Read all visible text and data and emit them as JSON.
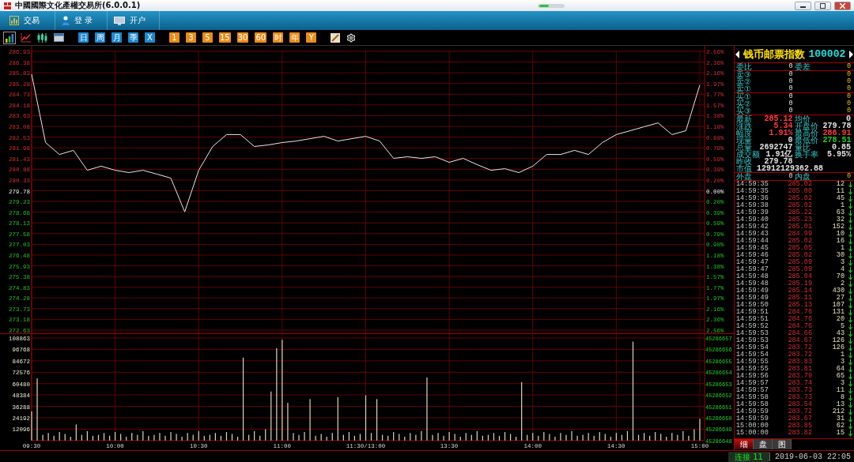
{
  "window": {
    "title": "中國國際文化產權交易所(6.0.0.1)"
  },
  "menu": [
    {
      "kind": "chart",
      "label": "交易"
    },
    {
      "kind": "user",
      "label": "登 录"
    },
    {
      "kind": "monitor",
      "label": "开户"
    }
  ],
  "toolbar": [
    {
      "kind": "bars",
      "selected": true
    },
    {
      "kind": "line",
      "selected": false
    },
    {
      "kind": "candles",
      "selected": false
    },
    {
      "kind": "window",
      "selected": false
    },
    {
      "kind": "period",
      "label": "日",
      "selected": false
    },
    {
      "kind": "period",
      "label": "周",
      "selected": false
    },
    {
      "kind": "period",
      "label": "月",
      "selected": false
    },
    {
      "kind": "period",
      "label": "季",
      "selected": false
    },
    {
      "kind": "period",
      "label": "X",
      "selected": false
    },
    {
      "kind": "minutes",
      "label": "1",
      "selected": false
    },
    {
      "kind": "minutes",
      "label": "3",
      "selected": false
    },
    {
      "kind": "minutes",
      "label": "5",
      "selected": false
    },
    {
      "kind": "minutes",
      "label": "15",
      "selected": false
    },
    {
      "kind": "minutes",
      "label": "30",
      "selected": false
    },
    {
      "kind": "minutes",
      "label": "60",
      "selected": false
    },
    {
      "kind": "minutes",
      "label": "时",
      "selected": false
    },
    {
      "kind": "minutes",
      "label": "年",
      "selected": false
    },
    {
      "kind": "minutes",
      "label": "Y",
      "selected": false
    },
    {
      "kind": "draw",
      "selected": false
    },
    {
      "kind": "settings",
      "selected": false
    }
  ],
  "price_chart": {
    "percent_labels": [
      "2.56%",
      "2.36%",
      "2.16%",
      "1.97%",
      "1.77%",
      "1.57%",
      "1.38%",
      "1.18%",
      "0.98%",
      "0.79%",
      "0.59%",
      "0.39%",
      "0.20%",
      "0.00%",
      "0.20%",
      "0.39%",
      "0.59%",
      "0.79%",
      "0.98%",
      "1.18%",
      "1.38%",
      "1.57%",
      "1.77%",
      "1.97%",
      "2.16%",
      "2.36%",
      "2.56%"
    ],
    "chart_data": {
      "type": "line",
      "grid": true,
      "ylim": [
        272.63,
        286.93
      ],
      "categories": [
        null,
        null,
        null,
        null,
        null,
        null,
        null,
        null,
        null,
        null,
        null,
        null,
        null,
        null,
        null,
        null,
        null,
        null,
        null,
        null,
        null,
        null,
        null,
        null,
        null,
        null,
        null,
        null,
        null,
        null,
        null,
        null,
        null,
        null,
        null,
        null,
        null,
        null,
        null,
        null,
        null,
        null,
        null,
        null,
        null,
        null,
        null,
        null,
        null
      ],
      "yticks": [
        {
          "value": 286.93,
          "label": "286.93"
        },
        {
          "value": 286.38,
          "label": "286.38"
        },
        {
          "value": 285.83,
          "label": "285.83"
        },
        {
          "value": 285.28,
          "label": "285.28"
        },
        {
          "value": 284.73,
          "label": "284.73"
        },
        {
          "value": 284.18,
          "label": "284.18"
        },
        {
          "value": 283.63,
          "label": "283.63"
        },
        {
          "value": 283.08,
          "label": "283.08"
        },
        {
          "value": 282.53,
          "label": "282.53"
        },
        {
          "value": 281.98,
          "label": "281.98"
        },
        {
          "value": 281.43,
          "label": "281.43"
        },
        {
          "value": 280.88,
          "label": "280.88"
        },
        {
          "value": 280.33,
          "label": "280.33"
        },
        {
          "value": 279.78,
          "label": "279.78"
        },
        {
          "value": 279.23,
          "label": "279.23"
        },
        {
          "value": 278.68,
          "label": "278.68"
        },
        {
          "value": 278.13,
          "label": "278.13"
        },
        {
          "value": 277.58,
          "label": "277.58"
        },
        {
          "value": 277.03,
          "label": "277.03"
        },
        {
          "value": 276.48,
          "label": "276.48"
        },
        {
          "value": 275.93,
          "label": "275.93"
        },
        {
          "value": 275.38,
          "label": "275.38"
        },
        {
          "value": 274.83,
          "label": "274.83"
        },
        {
          "value": 274.28,
          "label": "274.28"
        },
        {
          "value": 273.73,
          "label": "273.73"
        },
        {
          "value": 273.18,
          "label": "273.18"
        },
        {
          "value": 272.63,
          "label": "272.63"
        }
      ],
      "series": [
        {
          "color": "#e8e8e8",
          "values": [
            285.75,
            282.25,
            281.64,
            281.85,
            280.83,
            281.04,
            280.83,
            280.71,
            280.83,
            280.63,
            280.43,
            278.7,
            280.83,
            282.05,
            282.66,
            282.66,
            282.05,
            282.13,
            282.25,
            282.33,
            282.45,
            282.57,
            282.33,
            282.45,
            282.57,
            282.33,
            281.44,
            281.52,
            281.44,
            281.52,
            281.24,
            281.44,
            281.12,
            280.83,
            280.91,
            280.71,
            281.04,
            281.64,
            281.64,
            281.85,
            281.64,
            282.25,
            282.66,
            282.86,
            283.06,
            283.26,
            282.66,
            282.86,
            285.2
          ]
        }
      ]
    }
  },
  "volume_chart": {
    "right_labels": [
      "45286657",
      "45286656",
      "45286655",
      "45286654",
      "45286653",
      "45286652",
      "45286651",
      "45286650",
      "45286649",
      "45286648"
    ],
    "chart_data": {
      "type": "bar",
      "grid": true,
      "ylim": [
        0,
        108863
      ],
      "categories": [
        "09:30",
        null,
        null,
        null,
        null,
        null,
        null,
        null,
        null,
        null,
        null,
        null,
        null,
        null,
        null,
        "10:00",
        null,
        null,
        null,
        null,
        null,
        null,
        null,
        null,
        null,
        null,
        null,
        null,
        null,
        null,
        "10:30",
        null,
        null,
        null,
        null,
        null,
        null,
        null,
        null,
        null,
        null,
        null,
        null,
        null,
        null,
        "11:00",
        null,
        null,
        null,
        null,
        null,
        null,
        null,
        null,
        null,
        null,
        null,
        null,
        null,
        null,
        "11:30/13:00",
        null,
        null,
        null,
        null,
        null,
        null,
        null,
        null,
        null,
        null,
        null,
        null,
        null,
        null,
        "13:30",
        null,
        null,
        null,
        null,
        null,
        null,
        null,
        null,
        null,
        null,
        null,
        null,
        null,
        null,
        "14:00",
        null,
        null,
        null,
        null,
        null,
        null,
        null,
        null,
        null,
        null,
        null,
        null,
        null,
        null,
        "14:30",
        null,
        null,
        null,
        null,
        null,
        null,
        null,
        null,
        null,
        null,
        null,
        null,
        null,
        null,
        "15:00"
      ],
      "yticks": [
        108863,
        96768,
        84672,
        72576,
        60480,
        48384,
        36288,
        24192,
        12096
      ],
      "series": [
        {
          "color": "#d8d8b8",
          "values": [
            31000,
            66000,
            6000,
            8000,
            5000,
            9000,
            7000,
            4000,
            17000,
            6000,
            10000,
            5000,
            6000,
            8000,
            5000,
            9000,
            7000,
            4000,
            8000,
            6000,
            10000,
            5000,
            6000,
            8000,
            5000,
            9000,
            7000,
            4000,
            8000,
            6000,
            10000,
            5000,
            6000,
            8000,
            5000,
            9000,
            7000,
            4000,
            88000,
            6000,
            10000,
            5000,
            12000,
            52000,
            98000,
            107000,
            40000,
            8000,
            6000,
            9000,
            44000,
            5000,
            7000,
            4000,
            8000,
            46000,
            6000,
            9000,
            5000,
            7000,
            48000,
            8000,
            44000,
            6000,
            5000,
            9000,
            7000,
            4000,
            8000,
            6000,
            10000,
            67000,
            6000,
            8000,
            5000,
            9000,
            7000,
            4000,
            8000,
            6000,
            10000,
            5000,
            6000,
            8000,
            5000,
            9000,
            7000,
            4000,
            62000,
            6000,
            8000,
            5000,
            9000,
            7000,
            4000,
            8000,
            6000,
            10000,
            5000,
            6000,
            8000,
            5000,
            9000,
            7000,
            4000,
            8000,
            6000,
            10000,
            105000,
            6000,
            8000,
            5000,
            9000,
            7000,
            4000,
            8000,
            6000,
            10000,
            5000,
            12000,
            23000
          ]
        }
      ]
    }
  },
  "quote": {
    "name": "钱币邮票指数",
    "code": "100002",
    "ratio": [
      {
        "label": "委比",
        "value": "0"
      },
      {
        "label": "委差",
        "value": "0"
      }
    ],
    "sells": [
      {
        "label": "卖③",
        "price": "0",
        "volume": "0"
      },
      {
        "label": "卖②",
        "price": "0",
        "volume": "0"
      },
      {
        "label": "卖①",
        "price": "0",
        "volume": "0"
      }
    ],
    "buys": [
      {
        "label": "买①",
        "price": "0",
        "volume": "0"
      },
      {
        "label": "买②",
        "price": "0",
        "volume": "0"
      },
      {
        "label": "买③",
        "price": "0",
        "volume": "0"
      }
    ],
    "stats": [
      [
        {
          "kind": "half",
          "label": "最新",
          "value": "285.12",
          "color": "#ff3c3c"
        },
        {
          "kind": "half",
          "label": "均价",
          "value": "0",
          "color": "#e0e0e0"
        }
      ],
      [
        {
          "kind": "half",
          "label": "涨跌",
          "value": "5.34",
          "color": "#ff3c3c"
        },
        {
          "kind": "half",
          "label": "开盘价",
          "value": "279.78",
          "color": "#e0e0e0"
        }
      ],
      [
        {
          "kind": "half",
          "label": "幅度",
          "value": "1.91%",
          "color": "#ff3c3c"
        },
        {
          "kind": "half",
          "label": "最高价",
          "value": "286.91",
          "color": "#ff3c3c"
        }
      ],
      [
        {
          "kind": "half",
          "label": "现量",
          "value": "0",
          "color": "#e0e0e0"
        },
        {
          "kind": "half",
          "label": "最低价",
          "value": "278.51",
          "color": "#20d020"
        }
      ],
      [
        {
          "kind": "half",
          "label": "总量",
          "value": "2692747",
          "color": "#e0e0e0"
        },
        {
          "kind": "half",
          "label": "量比",
          "value": "0.85",
          "color": "#e0e0e0"
        }
      ],
      [
        {
          "kind": "half",
          "label": "成交额",
          "value": "1.91亿",
          "color": "#e0e0e0"
        },
        {
          "kind": "half",
          "label": "换手率",
          "value": "5.95%",
          "color": "#e0e0e0"
        }
      ],
      [
        {
          "kind": "half",
          "label": "昨收",
          "value": "279.78",
          "color": "#e0e0e0"
        }
      ],
      [
        {
          "kind": "wide",
          "label": "市值",
          "value": "12912129362.88",
          "color": "#e0e0e0"
        }
      ]
    ],
    "outer_inner": [
      {
        "label": "外盘",
        "value": "0"
      },
      {
        "label": "内盘",
        "value": "0"
      }
    ]
  },
  "ticks": [
    {
      "time": "14:59:35",
      "price": "285.02",
      "volume": "12"
    },
    {
      "time": "14:59:35",
      "price": "285.00",
      "volume": "11"
    },
    {
      "time": "14:59:36",
      "price": "285.02",
      "volume": "45"
    },
    {
      "time": "14:59:38",
      "price": "285.02",
      "volume": "1"
    },
    {
      "time": "14:59:39",
      "price": "285.22",
      "volume": "63"
    },
    {
      "time": "14:59:40",
      "price": "285.23",
      "volume": "32"
    },
    {
      "time": "14:59:42",
      "price": "285.01",
      "volume": "152"
    },
    {
      "time": "14:59:43",
      "price": "284.99",
      "volume": "10"
    },
    {
      "time": "14:59:44",
      "price": "285.02",
      "volume": "16"
    },
    {
      "time": "14:59:45",
      "price": "285.05",
      "volume": "1"
    },
    {
      "time": "14:59:46",
      "price": "285.02",
      "volume": "30"
    },
    {
      "time": "14:59:47",
      "price": "285.09",
      "volume": "3"
    },
    {
      "time": "14:59:47",
      "price": "285.09",
      "volume": "4"
    },
    {
      "time": "14:59:48",
      "price": "285.04",
      "volume": "70"
    },
    {
      "time": "14:59:48",
      "price": "285.19",
      "volume": "2"
    },
    {
      "time": "14:59:49",
      "price": "285.14",
      "volume": "430"
    },
    {
      "time": "14:59:49",
      "price": "285.11",
      "volume": "27"
    },
    {
      "time": "14:59:50",
      "price": "285.13",
      "volume": "107"
    },
    {
      "time": "14:59:51",
      "price": "284.76",
      "volume": "131"
    },
    {
      "time": "14:59:51",
      "price": "284.76",
      "volume": "20"
    },
    {
      "time": "14:59:52",
      "price": "284.76",
      "volume": "5"
    },
    {
      "time": "14:59:53",
      "price": "284.66",
      "volume": "43"
    },
    {
      "time": "14:59:53",
      "price": "284.67",
      "volume": "126"
    },
    {
      "time": "14:59:54",
      "price": "283.72",
      "volume": "126"
    },
    {
      "time": "14:59:54",
      "price": "283.72",
      "volume": "1"
    },
    {
      "time": "14:59:55",
      "price": "283.83",
      "volume": "3"
    },
    {
      "time": "14:59:55",
      "price": "283.81",
      "volume": "64"
    },
    {
      "time": "14:59:56",
      "price": "283.79",
      "volume": "65"
    },
    {
      "time": "14:59:57",
      "price": "283.74",
      "volume": "3"
    },
    {
      "time": "14:59:57",
      "price": "283.73",
      "volume": "11"
    },
    {
      "time": "14:59:58",
      "price": "283.73",
      "volume": "8"
    },
    {
      "time": "14:59:58",
      "price": "283.54",
      "volume": "13"
    },
    {
      "time": "14:59:59",
      "price": "283.72",
      "volume": "212"
    },
    {
      "time": "14:59:59",
      "price": "283.67",
      "volume": "31"
    },
    {
      "time": "15:00:00",
      "price": "283.85",
      "volume": "62"
    },
    {
      "time": "15:00:00",
      "price": "283.82",
      "volume": "15"
    }
  ],
  "detail_tabs": [
    {
      "label": "细",
      "selected": true
    },
    {
      "label": "盘",
      "selected": false
    },
    {
      "label": "图",
      "selected": false
    }
  ],
  "status_bar": {
    "connection": "连接 11",
    "datetime": "2019-06-03 22:05"
  }
}
